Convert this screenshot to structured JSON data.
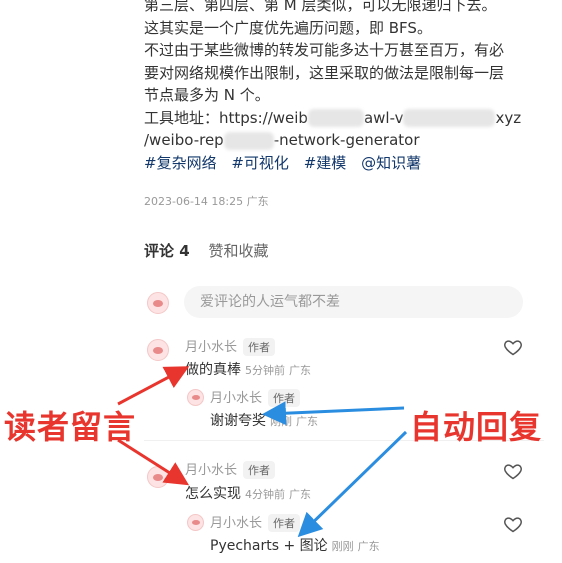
{
  "article": {
    "lines": [
      "第三层、第四层、第 M 层类似，可以无限递归下去。",
      "这其实是一个广度优先遍历问题，即 BFS。",
      "不过由于某些微博的转发可能多达十万甚至百万，有必",
      "要对网络规模作出限制，这里采取的做法是限制每一层",
      "节点最多为 N 个。"
    ],
    "tool_prefix": "工具地址：https://weib",
    "tool_mid": "awl-v",
    "tool_end": "xyz",
    "url2_start": "/weibo-rep",
    "url2_end": "-network-generator"
  },
  "tags": [
    "#复杂网络",
    "#可视化",
    "#建模",
    "@知识薯"
  ],
  "date": "2023-06-14 18:25 广东",
  "tabs": {
    "comments": "评论 4",
    "likes": "赞和收藏"
  },
  "comment_input": {
    "placeholder": "爱评论的人运气都不差"
  },
  "comments": [
    {
      "user": "月小水长",
      "badge": "作者",
      "text": "做的真棒",
      "time": "5分钟前",
      "loc": "广东"
    },
    {
      "user": "月小水长",
      "badge": "作者",
      "text": "谢谢夸奖",
      "time": "刚刚",
      "loc": "广东"
    },
    {
      "user": "月小水长",
      "badge": "作者",
      "text": "怎么实现",
      "time": "4分钟前",
      "loc": "广东"
    },
    {
      "user": "月小水长",
      "badge": "作者",
      "text": "Pyecharts + 图论",
      "time": "刚刚",
      "loc": "广东"
    }
  ],
  "annotations": {
    "left": "读者留言",
    "right": "自动回复"
  },
  "colors": {
    "arrow_red": "#e8352d",
    "arrow_blue": "#2a8de0",
    "tag": "#13386c"
  }
}
